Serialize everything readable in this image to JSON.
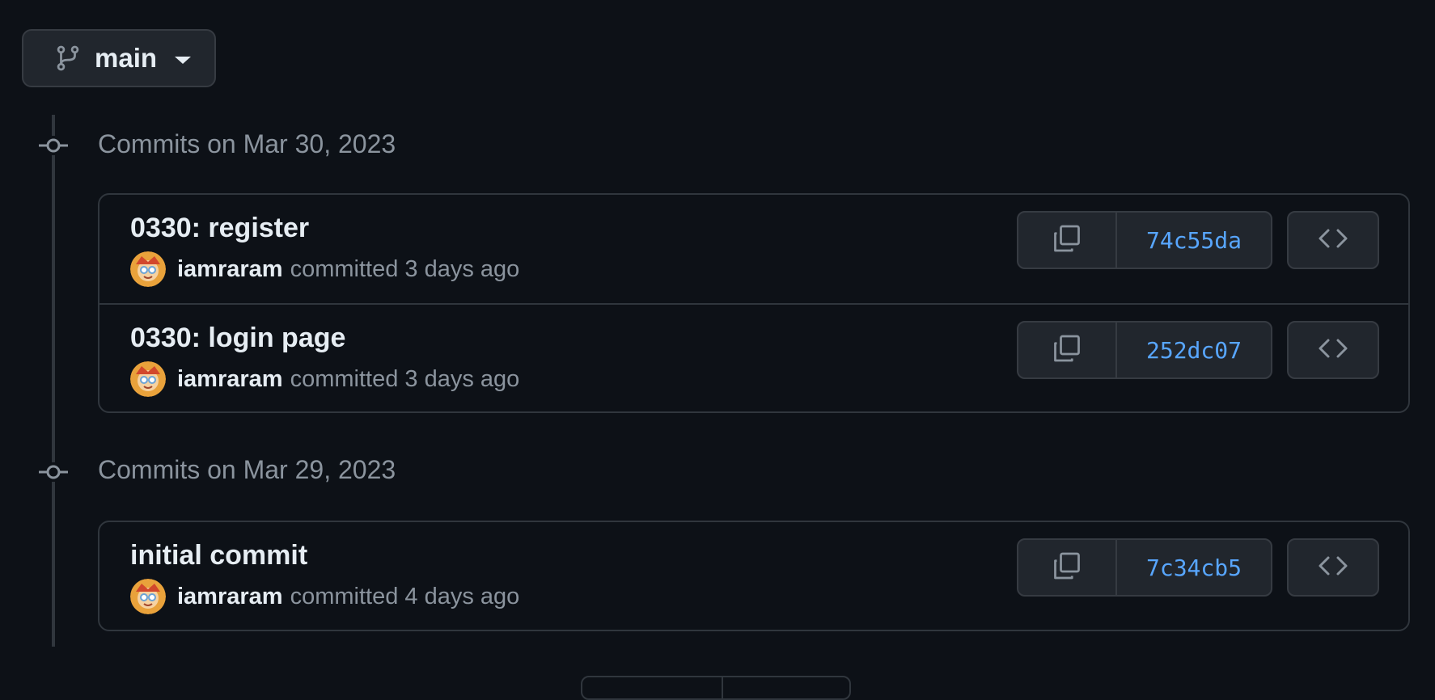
{
  "branch": {
    "name": "main",
    "icon": "git-branch-icon"
  },
  "groups": [
    {
      "heading": "Commits on Mar 30, 2023",
      "commits": [
        {
          "title": "0330: register",
          "author": "iamraram",
          "meta": "committed 3 days ago",
          "sha": "74c55da"
        },
        {
          "title": "0330: login page",
          "author": "iamraram",
          "meta": "committed 3 days ago",
          "sha": "252dc07"
        }
      ]
    },
    {
      "heading": "Commits on Mar 29, 2023",
      "commits": [
        {
          "title": "initial commit",
          "author": "iamraram",
          "meta": "committed 4 days ago",
          "sha": "7c34cb5"
        }
      ]
    }
  ],
  "icons": {
    "copy": "copy-icon",
    "browse": "code-icon",
    "commit_node": "git-commit-icon"
  },
  "colors": {
    "background": "#0d1117",
    "button": "#21262d",
    "border": "#30363d",
    "link": "#58a6ff",
    "muted": "#8b949e",
    "text": "#e6edf3"
  }
}
